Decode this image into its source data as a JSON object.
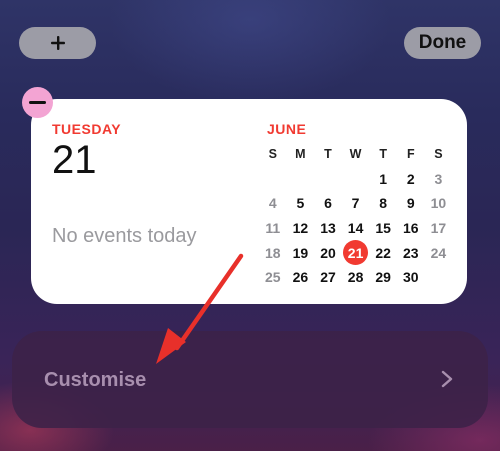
{
  "toolbar": {
    "add_icon": "plus-icon",
    "done_label": "Done"
  },
  "widget": {
    "remove_icon": "minus-icon",
    "day_name": "TUESDAY",
    "day_number": "21",
    "no_events": "No events today",
    "month": "JUNE",
    "weekday_headers": [
      "S",
      "M",
      "T",
      "W",
      "T",
      "F",
      "S"
    ],
    "weeks": [
      [
        "",
        "",
        "",
        "",
        "1",
        "2",
        "3"
      ],
      [
        "4",
        "5",
        "6",
        "7",
        "8",
        "9",
        "10"
      ],
      [
        "11",
        "12",
        "13",
        "14",
        "15",
        "16",
        "17"
      ],
      [
        "18",
        "19",
        "20",
        "21",
        "22",
        "23",
        "24"
      ],
      [
        "25",
        "26",
        "27",
        "28",
        "29",
        "30",
        ""
      ]
    ],
    "today": "21",
    "colors": {
      "accent": "#f13a31",
      "remove": "#f3a4d3"
    }
  },
  "customise": {
    "label": "Customise",
    "chevron_icon": "chevron-right-icon"
  },
  "annotation": {
    "arrow_color": "#e8302a"
  }
}
